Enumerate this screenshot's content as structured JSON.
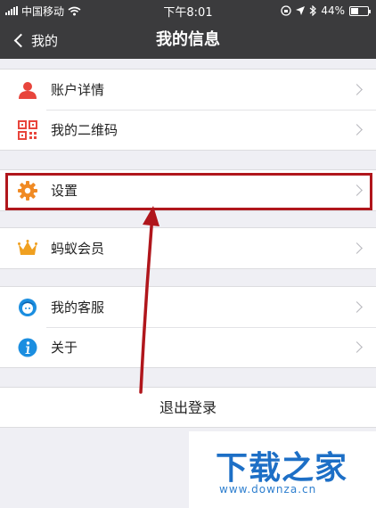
{
  "status_bar": {
    "carrier": "中国移动",
    "time": "下午8:01",
    "battery": "44%",
    "battery_level": 0.44
  },
  "nav": {
    "back_label": "我的",
    "title": "我的信息"
  },
  "groups": {
    "account": {
      "items": [
        {
          "label": "账户详情",
          "icon": "user-icon"
        },
        {
          "label": "我的二维码",
          "icon": "qr-code-icon"
        }
      ]
    },
    "settings": {
      "items": [
        {
          "label": "设置",
          "icon": "gear-icon"
        }
      ]
    },
    "membership": {
      "items": [
        {
          "label": "蚂蚁会员",
          "icon": "crown-icon"
        }
      ]
    },
    "support": {
      "items": [
        {
          "label": "我的客服",
          "icon": "customer-service-icon"
        },
        {
          "label": "关于",
          "icon": "info-icon"
        }
      ]
    }
  },
  "logout_label": "退出登录",
  "watermark": {
    "title": "下载之家",
    "url": "www.downza.cn"
  },
  "colors": {
    "bar": "#3b3b3d",
    "highlight": "#b0161c",
    "accent_orange": "#f08a24",
    "info_blue": "#1b8ee0"
  }
}
